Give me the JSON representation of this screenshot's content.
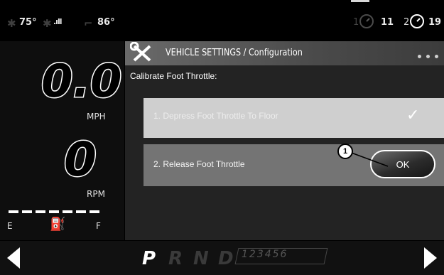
{
  "status_bar": {
    "ambient_temp": "75°",
    "engine_temp": "86°",
    "trip1_number": "1",
    "trip1_value": "11",
    "trip2_number": "2",
    "trip2_value": "19",
    "icons": [
      "thermometer-icon",
      "signal-icon",
      "engine-temp-icon",
      "trip-gauge-icon"
    ]
  },
  "gauges": {
    "speed": "0.0",
    "speed_unit": "MPH",
    "rpm": "0",
    "rpm_unit": "RPM",
    "fuel_empty": "E",
    "fuel_full": "F",
    "fuel_level": 1.0
  },
  "settings": {
    "title": "VEHICLE SETTINGS / Configuration",
    "subtitle": "Calibrate Foot Throttle:",
    "step1": "1. Depress Foot Throttle To Floor",
    "step2": "2. Release Foot Throttle",
    "ok_label": "OK",
    "callout": "1"
  },
  "gear_bar": {
    "gears": [
      "P",
      "R",
      "N",
      "D"
    ],
    "selected_gear": "P",
    "gear_numbers": "123456"
  },
  "colors": {
    "accent": "#ffffff",
    "step_active": "#747474",
    "step_done": "#cfcfcf"
  }
}
